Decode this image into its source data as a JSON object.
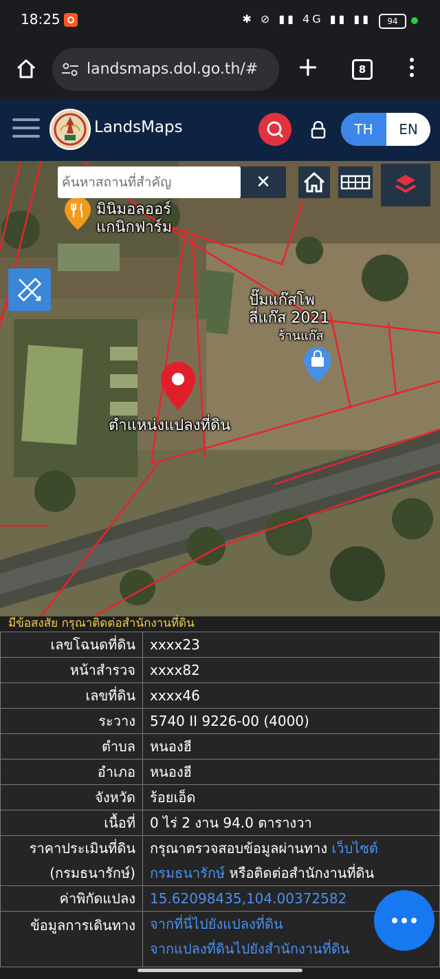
{
  "status_bar": {
    "time": "18:25",
    "icons_text": "✱ ⊘ ▮▮ 4G ▮▮ ▮▮",
    "battery": "94"
  },
  "browser": {
    "url": "landsmaps.dol.go.th/#",
    "tab_count": "8"
  },
  "app": {
    "title": "LandsMaps",
    "lang_th": "TH",
    "lang_en": "EN"
  },
  "map": {
    "search_placeholder": "ค้นหาสถานที่สำคัญ",
    "clear_label": "✕",
    "labels": {
      "poi_restaurant": "มินิมอลออร์\nแกนิกฟาร์ม",
      "poi_shop": "ปั๊มแก๊สโพ\nลี่แก๊ส 2021",
      "poi_shop_sub": "ร้านแก๊ส",
      "parcel_position": "ตำแหน่งแปลงที่ดิน"
    }
  },
  "info": {
    "notice": "มีข้อสงสัย กรุณาติดต่อสำนักงานที่ดิน",
    "rows": [
      {
        "key": "เลขโฉนดที่ดิน",
        "value": "xxxx23"
      },
      {
        "key": "หน้าสำรวจ",
        "value": "xxxx82"
      },
      {
        "key": "เลขที่ดิน",
        "value": "xxxx46"
      },
      {
        "key": "ระวาง",
        "value": "5740 II 9226-00 (4000)"
      },
      {
        "key": "ตำบล",
        "value": "หนองฮี"
      },
      {
        "key": "อำเภอ",
        "value": "หนองฮี"
      },
      {
        "key": "จังหวัด",
        "value": "ร้อยเอ็ด"
      },
      {
        "key": "เนื้อที่",
        "value": "0 ไร่ 2 งาน 94.0 ตารางวา"
      }
    ],
    "price": {
      "key_line1": "ราคาประเมินที่ดิน",
      "key_line2": "(กรมธนารักษ์)",
      "value_prefix": "กรุณาตรวจสอบข้อมูลผ่านทาง",
      "link_website": "เว็บไซต์",
      "link_treasury": "กรมธนารักษ์",
      "value_suffix": "หรือติดต่อสำนักงานที่ดิน"
    },
    "coords": {
      "key": "ค่าพิกัดแปลง",
      "value": "15.62098435,104.00372582"
    },
    "travel": {
      "key": "ข้อมูลการเดินทาง",
      "link1": "จากที่นี่ไปยังแปลงที่ดิน",
      "link2": "จากแปลงที่ดินไปยังสำนักงานที่ดิน"
    }
  },
  "colors": {
    "app_bar": "#0d2341",
    "search_red": "#e1323f",
    "lang_active": "#3d86e9",
    "link": "#4a8ff0",
    "fab": "#1679f2",
    "parcel_line": "#e8242c"
  }
}
